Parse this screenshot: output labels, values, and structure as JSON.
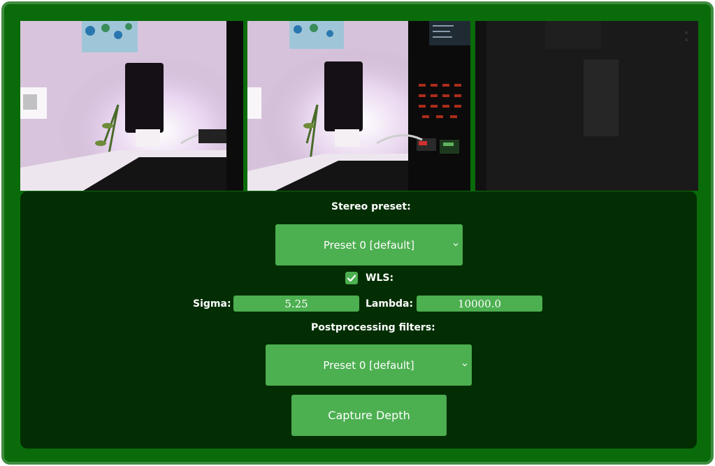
{
  "streams": {
    "left_camera": {
      "label": "left-camera-feed"
    },
    "right_camera": {
      "label": "right-camera-feed"
    },
    "depth": {
      "label": "depth-map-feed"
    }
  },
  "controls": {
    "stereo_preset_label": "Stereo preset:",
    "stereo_preset_value": "Preset 0 [default]",
    "wls_label": "WLS:",
    "wls_checked": true,
    "sigma_label": "Sigma:",
    "sigma_value": "5.25",
    "lambda_label": "Lambda:",
    "lambda_value": "10000.0",
    "postprocessing_label": "Postprocessing filters:",
    "postprocessing_value": "Preset 0 [default]",
    "capture_button": "Capture Depth"
  },
  "icons": {
    "dropdown": "chevron-down-icon",
    "check": "check-icon"
  },
  "colors": {
    "frame": "#0a6b0a",
    "frame_border": "#3f8c3f",
    "panel": "#032e03",
    "accent": "#4caf50"
  }
}
